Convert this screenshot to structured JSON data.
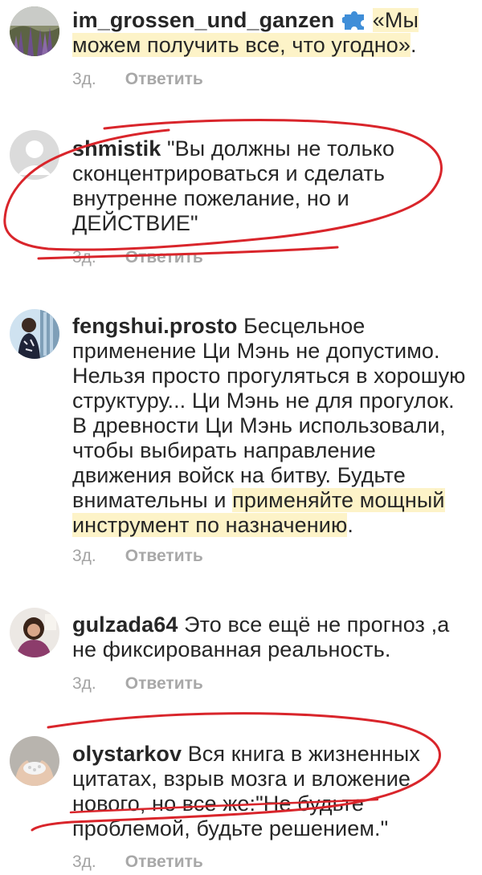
{
  "comments": [
    {
      "username": "im_grossen_und_ganzen",
      "icon": "puzzle-piece-icon",
      "text_highlighted": "«Мы можем получить все, что угодно»",
      "text_after": ".",
      "time": "3д.",
      "reply": "Ответить"
    },
    {
      "username": "shmistik",
      "text": "\"Вы должны не только сконцентрироваться и сделать внутренне пожелание, но и ДЕЙСТВИЕ\"",
      "time": "3д.",
      "reply": "Ответить"
    },
    {
      "username": "fengshui.prosto",
      "text": "Бесцельное применение Ци Мэнь не допустимо. Нельзя просто прогуляться в хорошую структуру... Ци Мэнь не для прогулок. В древности Ци Мэнь использовали, чтобы выбирать направление движения войск на битву. Будьте внимательны и ",
      "text_highlighted": "применяйте мощный инструмент по назначению",
      "text_after": ".",
      "time": "3д.",
      "reply": "Ответить"
    },
    {
      "username": "gulzada64",
      "text": "Это все ещё не прогноз ,а не фиксированная реальность.",
      "time": "3д.",
      "reply": "Ответить"
    },
    {
      "username": "olystarkov",
      "text": "Вся книга в жизненных цитатах, взрыв мозга и вложение нового, но все же:\"Не будьте проблемой, будьте решением.\"",
      "time": "3д.",
      "reply": "Ответить"
    }
  ],
  "colors": {
    "annotation_red": "#d9252b",
    "highlight_yellow": "#fdf3c8",
    "meta_gray": "#a4a4a4"
  }
}
